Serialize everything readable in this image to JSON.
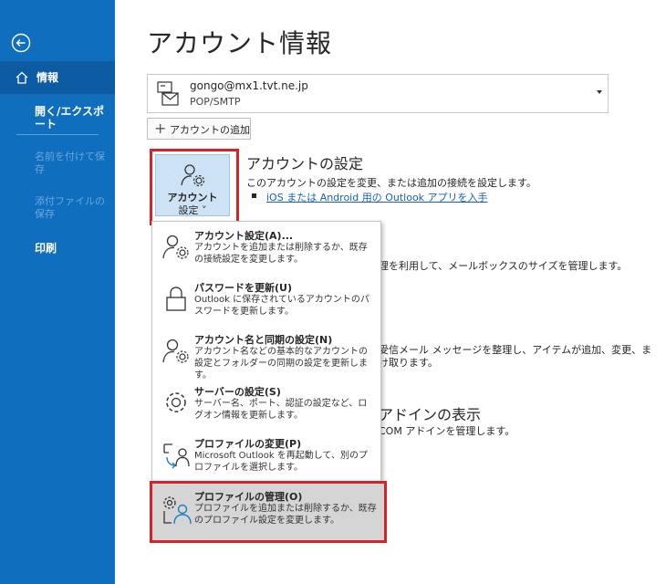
{
  "sidebar": {
    "info_label": "情報",
    "open_export_label": "開く/エクスポート",
    "save_as_label": "名前を付けて保存",
    "save_attachments_label": "添付ファイルの保存",
    "print_label": "印刷"
  },
  "main": {
    "title": "アカウント情報",
    "account": {
      "email": "gongo@mx1.tvt.ne.jp",
      "type": "POP/SMTP"
    },
    "add_account_label": "アカウントの追加",
    "account_settings_button": {
      "line1": "アカウント",
      "line2": "設定 ˅"
    },
    "section": {
      "title": "アカウントの設定",
      "desc": "このアカウントの設定を変更、または追加の接続を設定します。",
      "link": "iOS または Android 用の Outlook アプリを入手"
    },
    "behind": {
      "line1": "理を利用して、メールボックスのサイズを管理します。",
      "line2": "受信メール メッセージを整理し、アイテムが追加、変更、ま",
      "line3": "け取ります。",
      "title4": "アドインの表示",
      "line4": "COM アドインを管理します。"
    }
  },
  "menu": {
    "items": [
      {
        "title": "アカウント設定(A)...",
        "desc": "アカウントを追加または削除するか、既存の接続設定を変更します。"
      },
      {
        "title": "パスワードを更新(U)",
        "desc": "Outlook に保存されているアカウントのパスワードを更新します。"
      },
      {
        "title": "アカウント名と同期の設定(N)",
        "desc": "アカウント名などの基本的なアカウントの設定とフォルダーの同期の設定を更新します。"
      },
      {
        "title": "サーバーの設定(S)",
        "desc": "サーバー名、ポート、認証の設定など、ログオン情報を更新します。"
      },
      {
        "title": "プロファイルの変更(P)",
        "desc": "Microsoft Outlook を再起動して、別のプロファイルを選択します。"
      },
      {
        "title": "プロファイルの管理(O)",
        "desc": "プロファイルを追加または削除するか、既存のプロファイル設定を変更します。"
      }
    ]
  },
  "colors": {
    "sidebar": "#106ebe",
    "sidebar_selected": "#0c5ba3",
    "highlight_border": "#d4232a",
    "link": "#1a5fb4"
  }
}
